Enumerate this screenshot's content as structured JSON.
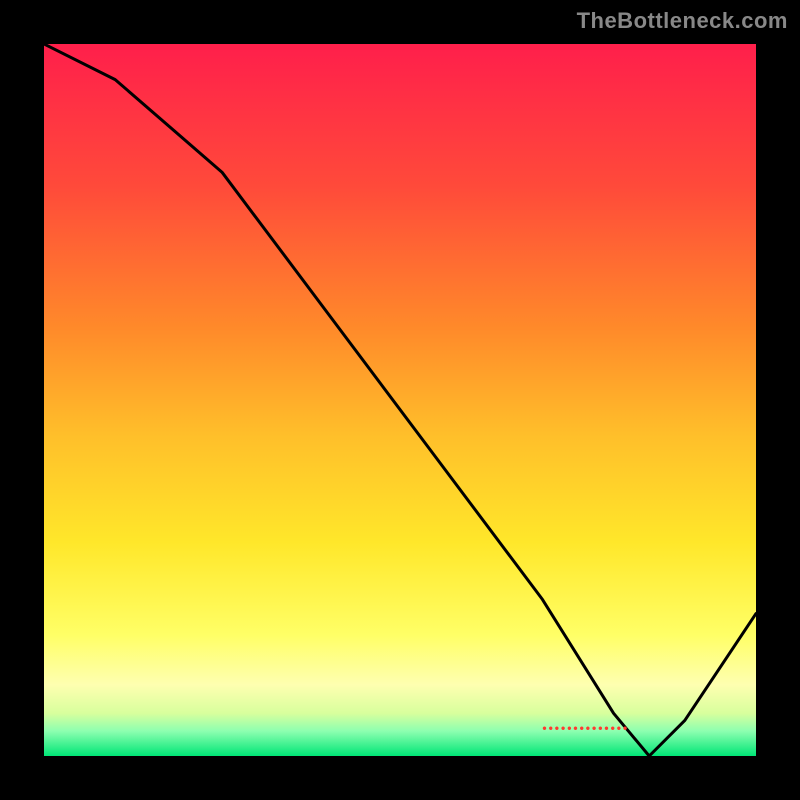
{
  "watermark": "TheBottleneck.com",
  "chart_data": {
    "type": "line",
    "title": "",
    "xlabel": "",
    "ylabel": "",
    "xlim": [
      0,
      100
    ],
    "ylim": [
      0,
      100
    ],
    "grid": false,
    "legend": false,
    "gradient_stops": [
      {
        "pos": 0.0,
        "color": "#ff1f4b"
      },
      {
        "pos": 0.2,
        "color": "#ff4a3a"
      },
      {
        "pos": 0.4,
        "color": "#ff8a2a"
      },
      {
        "pos": 0.55,
        "color": "#ffbf2a"
      },
      {
        "pos": 0.7,
        "color": "#ffe72a"
      },
      {
        "pos": 0.83,
        "color": "#ffff66"
      },
      {
        "pos": 0.9,
        "color": "#feffb0"
      },
      {
        "pos": 0.94,
        "color": "#d8ff9d"
      },
      {
        "pos": 0.965,
        "color": "#8dffb0"
      },
      {
        "pos": 1.0,
        "color": "#00e676"
      }
    ],
    "series": [
      {
        "name": "curve",
        "x": [
          0,
          10,
          25,
          40,
          55,
          70,
          80,
          85,
          90,
          100
        ],
        "y": [
          100,
          95,
          82,
          62,
          42,
          22,
          6,
          0,
          5,
          20
        ]
      }
    ],
    "marker": {
      "label": "••••••••••••••",
      "x_pct": 80,
      "y_pct": 3
    }
  }
}
